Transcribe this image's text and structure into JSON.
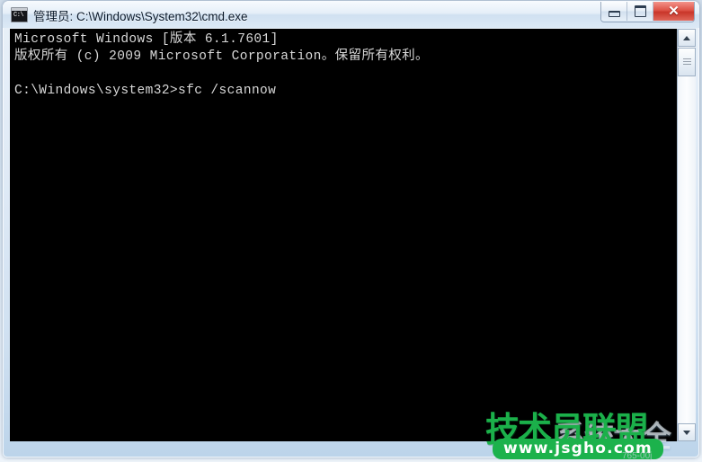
{
  "window": {
    "title": "管理员: C:\\Windows\\System32\\cmd.exe",
    "icon": "cmd-icon",
    "icon_prompt": "C:\\",
    "buttons": {
      "minimize_label": "",
      "maximize_label": "",
      "close_label": "✕"
    }
  },
  "console": {
    "lines": [
      "Microsoft Windows [版本 6.1.7601]",
      "版权所有 (c) 2009 Microsoft Corporation。保留所有权利。",
      "",
      "C:\\Windows\\system32>sfc /scannow"
    ],
    "text": "Microsoft Windows [版本 6.1.7601]\n版权所有 (c) 2009 Microsoft Corporation。保留所有权利。\n\nC:\\Windows\\system32>sfc /scannow",
    "background_color": "#000000",
    "foreground_color": "#d8d8d8"
  },
  "scrollbar": {
    "up_arrow": "scroll-up-arrow",
    "down_arrow": "scroll-down-arrow",
    "thumb": "scroll-thumb"
  },
  "watermark": {
    "brand": "技术员联盟",
    "ghost": "系统大全",
    "url": "www.jsgho.com",
    "code": "765-00j",
    "brand_color": "#1bb04a",
    "badge_color": "#1cb24c"
  }
}
